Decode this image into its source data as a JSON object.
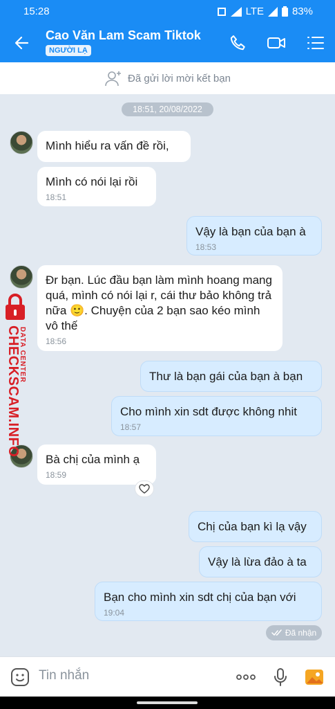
{
  "status": {
    "time": "15:28",
    "network": "LTE",
    "battery": "83%"
  },
  "header": {
    "title": "Cao Văn Lam Scam Tiktok",
    "badge": "NGƯỜI LẠ"
  },
  "friendbar": {
    "text": "Đã gửi lời mời kết bạn"
  },
  "date_chip": "18:51, 20/08/2022",
  "messages": [
    {
      "text": "Mình hiểu ra vấn đề rồi,",
      "time": ""
    },
    {
      "text": "Mình có nói lại rồi",
      "time": "18:51"
    },
    {
      "text": "Vậy là bạn của bạn à",
      "time": "18:53"
    },
    {
      "text": "Đr bạn. Lúc đầu bạn làm mình hoang mang quá, mình có nói lại r, cái thư bảo không trả nữa 🙂. Chuyện của 2 bạn sao kéo mình vô thế",
      "time": "18:56"
    },
    {
      "text": "Thư là bạn gái của bạn à bạn",
      "time": ""
    },
    {
      "text": "Cho mình xin sdt được không nhit",
      "time": "18:57"
    },
    {
      "text": "Bà chị của mình ạ",
      "time": "18:59"
    },
    {
      "text": "Chị của bạn kì lạ vậy",
      "time": ""
    },
    {
      "text": "Vậy là lừa đảo à ta",
      "time": ""
    },
    {
      "text": "Bạn cho mình xin sdt chị của bạn với",
      "time": "19:04"
    }
  ],
  "seen_label": "Đã nhận",
  "composer": {
    "placeholder": "Tin nhắn"
  },
  "watermark": {
    "line1": "DATA CENTER",
    "line2": "CHECKSCAM.INFO"
  },
  "colors": {
    "brand": "#1a8cf5",
    "outgoing": "#d7ecff",
    "background": "#e2e9f1"
  },
  "icons": [
    "back-arrow-icon",
    "phone-icon",
    "video-call-icon",
    "menu-list-icon",
    "add-friend-icon",
    "heart-icon",
    "double-check-icon",
    "sticker-icon",
    "more-dots-icon",
    "microphone-icon",
    "image-icon",
    "lock-icon"
  ]
}
